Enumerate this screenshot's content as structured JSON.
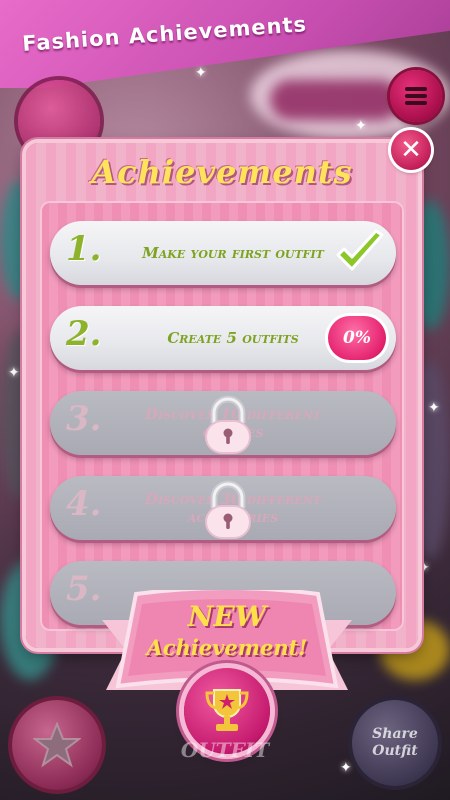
{
  "header": {
    "title": "Fashion Achievements"
  },
  "panel": {
    "title": "Achievements",
    "close_icon": "close-icon"
  },
  "achievements": [
    {
      "number": "1.",
      "label": "Make your first outfit",
      "status": "completed"
    },
    {
      "number": "2.",
      "label": "Create 5 outfits",
      "progress": "0%"
    },
    {
      "number": "3.",
      "label": "Discover 10 different clothes",
      "status": "locked"
    },
    {
      "number": "4.",
      "label": "Discover 30 different accessories",
      "status": "locked"
    },
    {
      "number": "5.",
      "label": "",
      "status": "locked"
    }
  ],
  "popup": {
    "line1": "NEW",
    "line2": "Achievement!"
  },
  "bottom": {
    "outfit_label": "OUTFIT",
    "share_label_1": "Share",
    "share_label_2": "Outfit"
  },
  "colors": {
    "accent_pink": "#e52470",
    "title_yellow": "#ffe35a",
    "check_green": "#8cb32b"
  }
}
